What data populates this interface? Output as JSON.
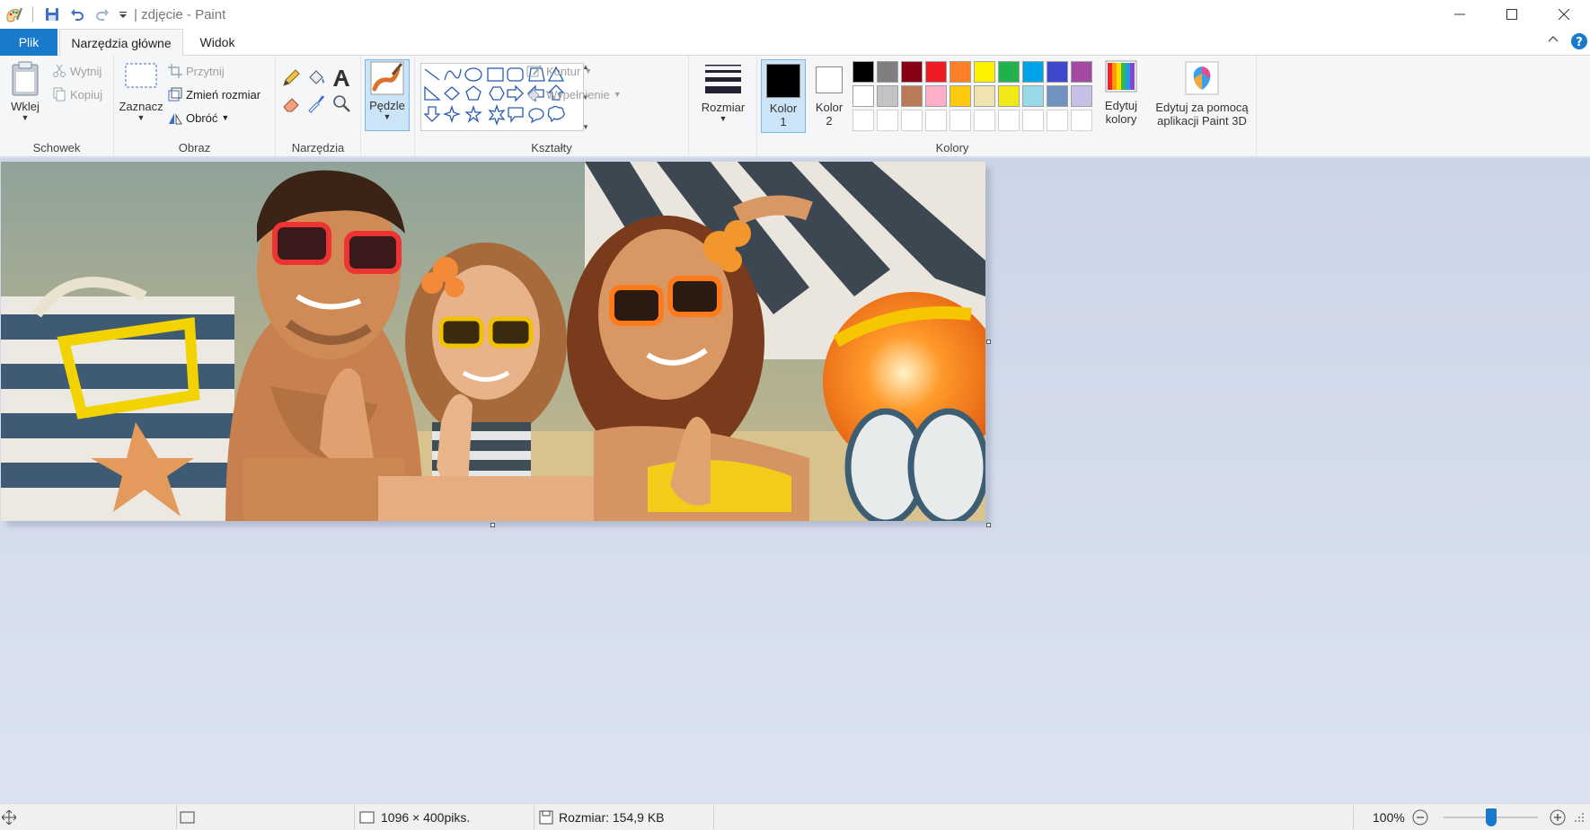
{
  "window": {
    "title": "| zdjęcie - Paint"
  },
  "tabs": {
    "file": "Plik",
    "home": "Narzędzia główne",
    "view": "Widok"
  },
  "ribbon": {
    "clipboard": {
      "label": "Schowek",
      "paste": "Wklej",
      "cut": "Wytnij",
      "copy": "Kopiuj"
    },
    "image": {
      "label": "Obraz",
      "select": "Zaznacz",
      "crop": "Przytnij",
      "resize": "Zmień rozmiar",
      "rotate": "Obróć"
    },
    "tools": {
      "label": "Narzędzia"
    },
    "brushes": {
      "label": "Pędzle"
    },
    "shapes": {
      "label": "Kształty",
      "outline": "Kontur",
      "fill": "Wypełnienie"
    },
    "size": {
      "label": "Rozmiar"
    },
    "colors": {
      "label": "Kolory",
      "color1": "Kolor",
      "color1_num": "1",
      "color2": "Kolor",
      "color2_num": "2",
      "edit_colors_1": "Edytuj",
      "edit_colors_2": "kolory",
      "color1_value": "#000000",
      "color2_value": "#ffffff",
      "palette_row1": [
        "#000000",
        "#7f7f7f",
        "#880015",
        "#ed1c24",
        "#ff7f27",
        "#fff200",
        "#22b14c",
        "#00a2e8",
        "#3f48cc",
        "#a349a4"
      ],
      "palette_row2": [
        "#ffffff",
        "#c3c3c3",
        "#b97a57",
        "#ffaec9",
        "#ffc90e",
        "#efe4b0",
        "#f0e817",
        "#99d9ea",
        "#7092be",
        "#c8bfe7"
      ]
    },
    "paint3d": {
      "line1": "Edytuj za pomocą",
      "line2": "aplikacji Paint 3D"
    }
  },
  "status": {
    "dimensions": "1096 × 400piks.",
    "filesize": "Rozmiar: 154,9 KB",
    "zoom": "100%",
    "zoom_level": 0.5
  }
}
